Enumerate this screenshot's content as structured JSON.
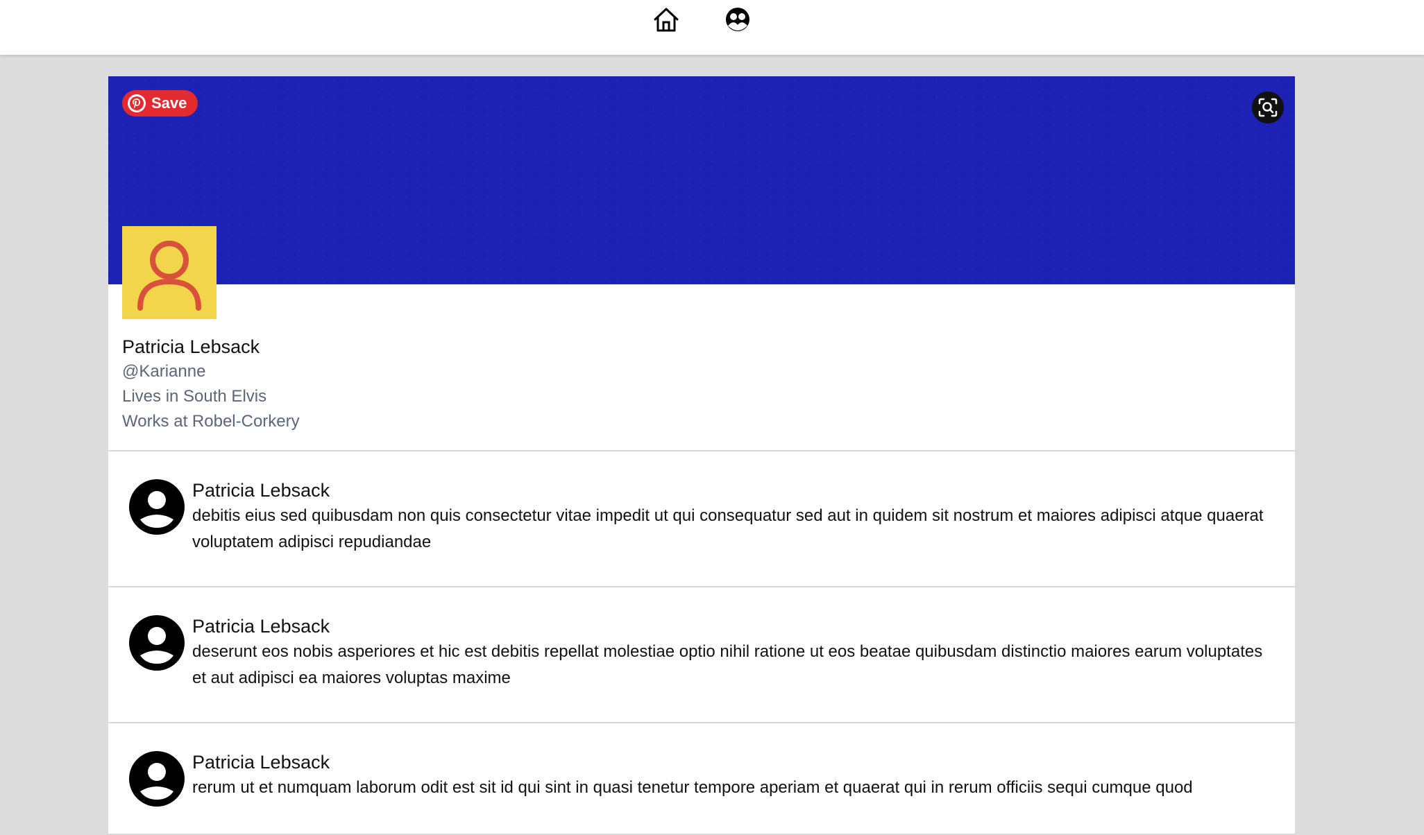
{
  "nav": {
    "home_icon": "home-icon",
    "people_icon": "people-icon"
  },
  "cover": {
    "color": "#1d22b4",
    "save_label": "Save",
    "save_color": "#e32a2f",
    "lens_icon": "visual-search-icon"
  },
  "profile": {
    "avatar_bg": "#f2d54b",
    "avatar_icon_color": "#d9513a",
    "name": "Patricia Lebsack",
    "handle": "@Karianne",
    "location": "Lives in South Elvis",
    "work": "Works at Robel-Corkery"
  },
  "posts": [
    {
      "author": "Patricia Lebsack",
      "text": "debitis eius sed quibusdam non quis consectetur vitae impedit ut qui consequatur sed aut in quidem sit nostrum et maiores adipisci atque quaerat voluptatem adipisci repudiandae"
    },
    {
      "author": "Patricia Lebsack",
      "text": "deserunt eos nobis asperiores et hic est debitis repellat molestiae optio nihil ratione ut eos beatae quibusdam distinctio maiores earum voluptates et aut adipisci ea maiores voluptas maxime"
    },
    {
      "author": "Patricia Lebsack",
      "text": "rerum ut et numquam laborum odit est sit id qui sint in quasi tenetur tempore aperiam et quaerat qui in rerum officiis sequi cumque quod"
    }
  ]
}
